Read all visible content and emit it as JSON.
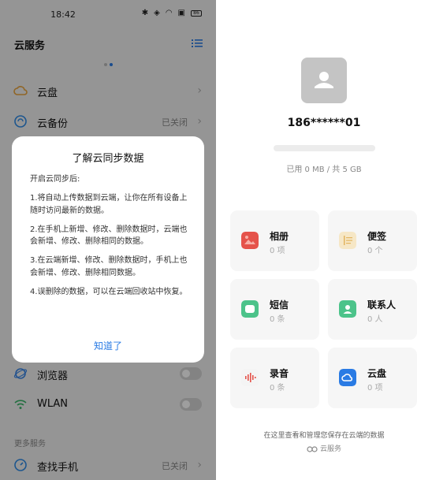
{
  "status_bar": {
    "time": "18:42",
    "icons": [
      "bluetooth-icon",
      "vibrate-icon",
      "wifi-icon",
      "sim-icon",
      "battery-icon"
    ],
    "battery": "86"
  },
  "left_panel": {
    "title": "云服务",
    "rows": [
      {
        "label": "云盘",
        "value": "",
        "icon": "cloud-drive-icon",
        "icon_color": "#e8a33c",
        "control": "chevron"
      },
      {
        "label": "云备份",
        "value": "已关闭",
        "icon": "cloud-backup-icon",
        "icon_color": "#2f8be6",
        "control": "chevron"
      },
      {
        "label": "浏览器",
        "value": "",
        "icon": "browser-icon",
        "icon_color": "#3b86e6",
        "control": "toggle"
      },
      {
        "label": "WLAN",
        "value": "",
        "icon": "wifi-icon",
        "icon_color": "#3bb36a",
        "control": "toggle"
      }
    ],
    "section_more": "更多服务",
    "find_phone": {
      "label": "查找手机",
      "value": "已关闭",
      "icon": "find-phone-icon",
      "icon_color": "#2f8be6"
    }
  },
  "dialog": {
    "title": "了解云同步数据",
    "paragraphs": [
      "开启云同步后:",
      "1.将自动上传数据到云端，让你在所有设备上随时访问最新的数据。",
      "2.在手机上新增、修改、删除数据时，云端也会新增、修改、删除相同的数据。",
      "3.在云端新增、修改、删除数据时，手机上也会新增、修改、删除相同数据。",
      "4.误删除的数据，可以在云端回收站中恢复。"
    ],
    "ok_label": "知道了"
  },
  "right_panel": {
    "phone": "186******01",
    "usage": "已用 0 MB / 共 5 GB",
    "usage_fraction": 0,
    "cards": [
      {
        "name": "相册",
        "count": "0 项",
        "icon": "gallery-icon",
        "color": "#e5534b"
      },
      {
        "name": "便签",
        "count": "0 个",
        "icon": "notes-icon",
        "color": "#f1d9a6"
      },
      {
        "name": "短信",
        "count": "0 条",
        "icon": "messages-icon",
        "color": "#4cc38a"
      },
      {
        "name": "联系人",
        "count": "0 人",
        "icon": "contacts-icon",
        "color": "#4cc38a"
      },
      {
        "name": "录音",
        "count": "0 条",
        "icon": "recorder-icon",
        "color": "#e5534b"
      },
      {
        "name": "云盘",
        "count": "0 项",
        "icon": "cloud-drive-icon",
        "color": "#2a7be4"
      }
    ],
    "footer_text": "在这里查看和管理您保存在云端的数据",
    "footer_brand": "云服务"
  }
}
